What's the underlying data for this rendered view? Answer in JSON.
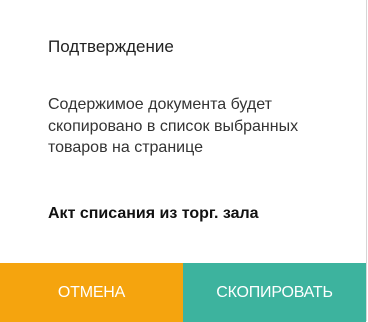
{
  "dialog": {
    "title": "Подтверждение",
    "message": "Содержимое документа будет скопировано в список выбранных товаров на странице",
    "document_name": "Акт списания из торг. зала",
    "buttons": {
      "cancel_label": "ОТМЕНА",
      "confirm_label": "СКОПИРОВАТЬ"
    }
  },
  "colors": {
    "cancel_bg": "#F5A40E",
    "confirm_bg": "#3DB39E",
    "background": "#FFFFFF"
  }
}
